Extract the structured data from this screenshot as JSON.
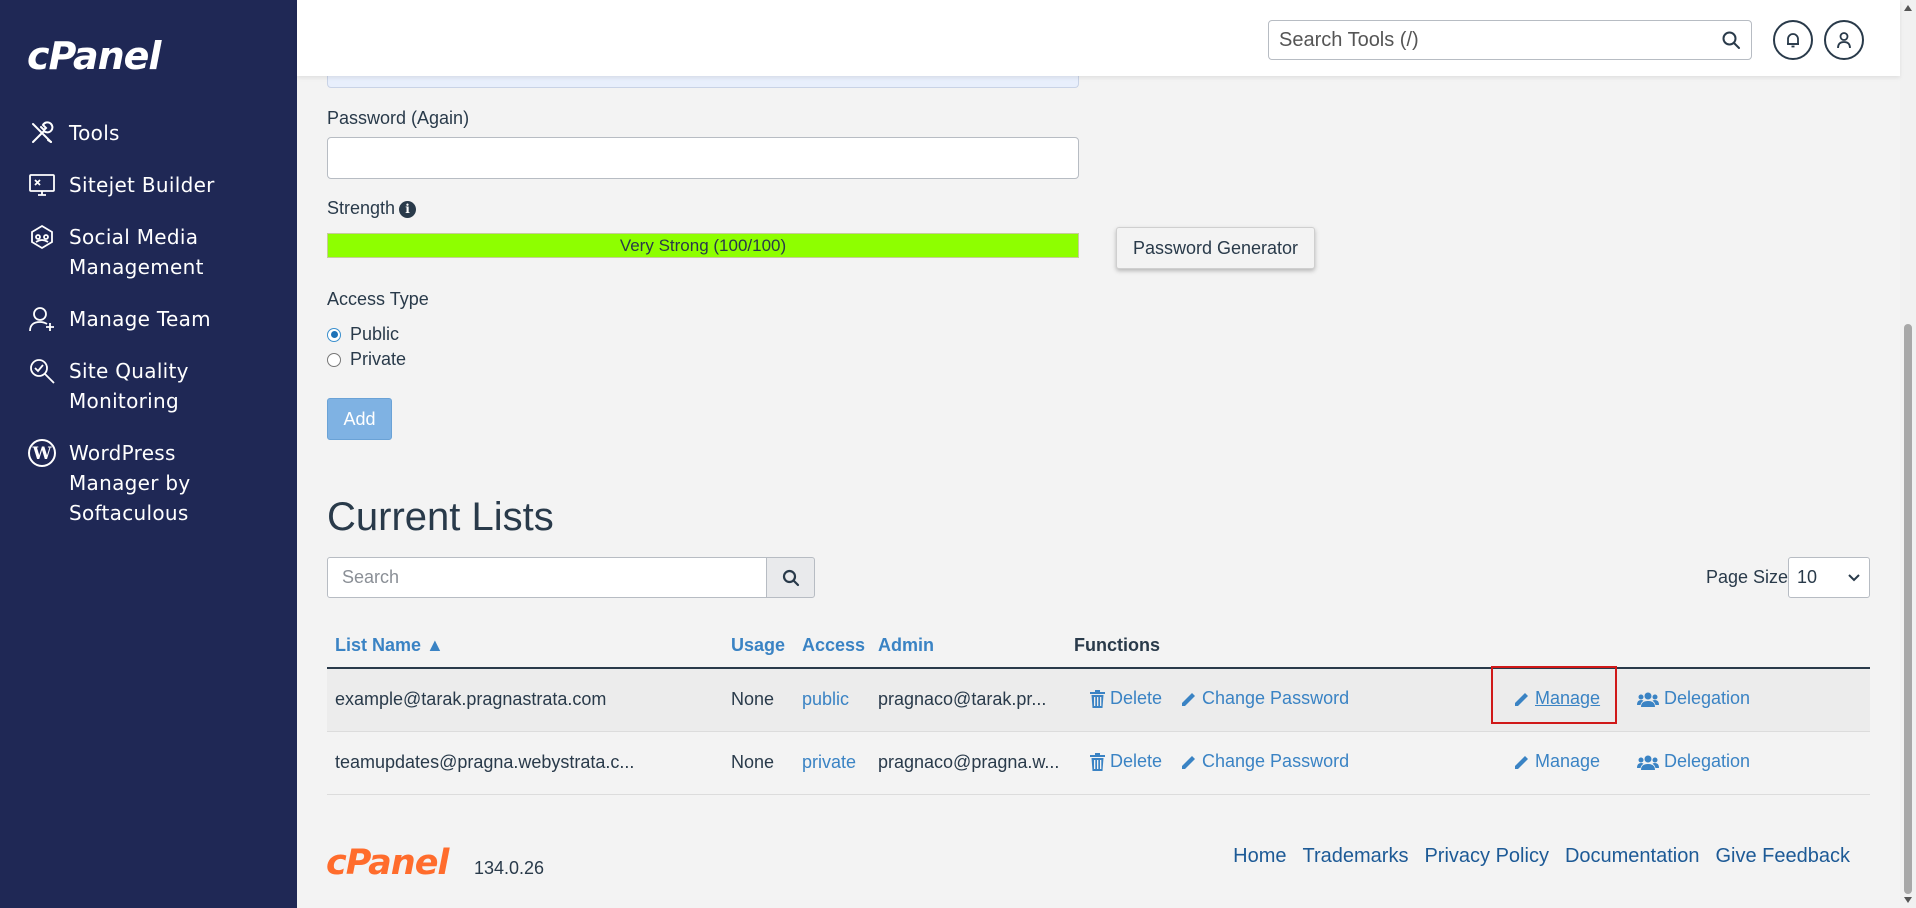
{
  "app": {
    "logo": "cPanel"
  },
  "sidebar": {
    "items": [
      {
        "label": "Tools",
        "icon": "tools-icon"
      },
      {
        "label": "Sitejet Builder",
        "icon": "monitor-icon"
      },
      {
        "label": "Social Media\nManagement",
        "icon": "social-icon"
      },
      {
        "label": "Manage Team",
        "icon": "user-plus-icon"
      },
      {
        "label": "Site Quality\nMonitoring",
        "icon": "magnify-icon"
      },
      {
        "label": "WordPress\nManager by\nSoftaculous",
        "icon": "wordpress-icon"
      }
    ]
  },
  "header": {
    "search_placeholder": "Search Tools (/)"
  },
  "form": {
    "password_again_label": "Password (Again)",
    "strength_label": "Strength",
    "strength_text": "Very Strong (100/100)",
    "strength_value": 100,
    "password_generator_label": "Password Generator",
    "access_type_label": "Access Type",
    "access_options": [
      "Public",
      "Private"
    ],
    "access_selected": "Public",
    "add_label": "Add"
  },
  "lists": {
    "heading": "Current Lists",
    "search_placeholder": "Search",
    "page_size_label": "Page Size",
    "page_size_value": "10",
    "columns": [
      "List Name ▲",
      "Usage",
      "Access",
      "Admin",
      "Functions"
    ],
    "rows": [
      {
        "name": "example@tarak.pragnastrata.com",
        "usage": "None",
        "access": "public",
        "admin": "pragnaco@tarak.pr..."
      },
      {
        "name": "teamupdates@pragna.webystrata.c...",
        "usage": "None",
        "access": "private",
        "admin": "pragnaco@pragna.w..."
      }
    ],
    "functions": {
      "delete": "Delete",
      "change_password": "Change Password",
      "manage": "Manage",
      "delegation": "Delegation"
    }
  },
  "footer": {
    "logo": "cPanel",
    "version": "134.0.26",
    "links": [
      "Home",
      "Trademarks",
      "Privacy Policy",
      "Documentation",
      "Give Feedback"
    ]
  }
}
